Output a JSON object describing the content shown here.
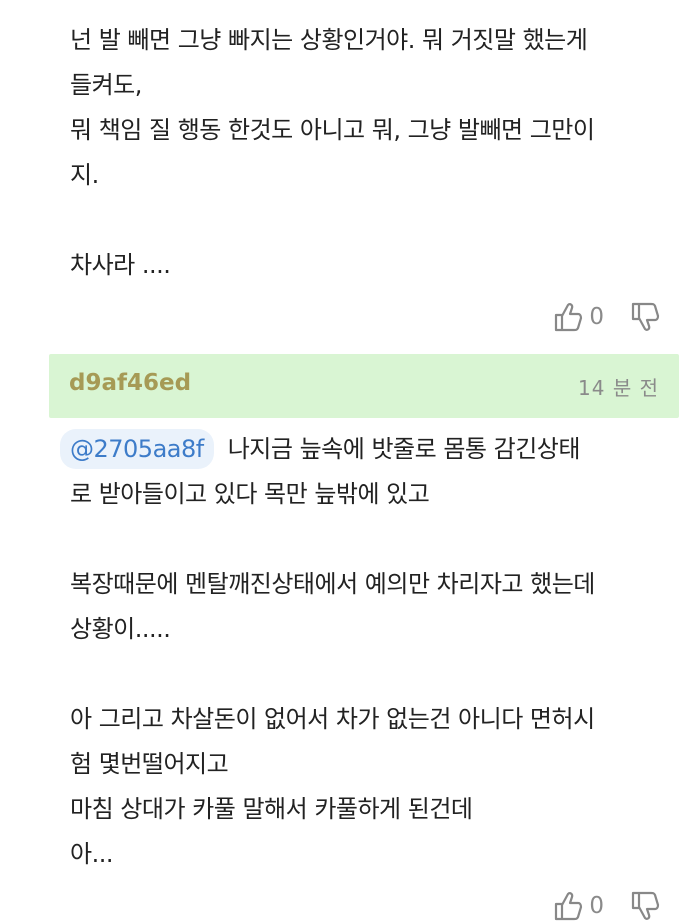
{
  "comment1": {
    "lines": [
      "넌 발 빼면 그냥 빠지는 상황인거야. 뭐 거짓말 했는게",
      "들켜도,",
      "뭐 책임 질 행동 한것도 아니고 뭐, 그냥 발빼면 그만이",
      "지.",
      "",
      "차사라 ...."
    ],
    "likes": "0",
    "like_icon": "thumbs-up-icon",
    "dislike_icon": "thumbs-down-icon"
  },
  "comment2": {
    "author": "d9af46ed",
    "time": "14 분 전",
    "mention": "@2705aa8f",
    "first_line": "나지금 늪속에 밧줄로 몸통 감긴상태",
    "lines": [
      "로 받아들이고 있다 목만 늪밖에 있고",
      "",
      "복장때문에 멘탈깨진상태에서 예의만 차리자고 했는데",
      "상황이.....",
      "",
      "아 그리고 차살돈이 없어서 차가 없는건 아니다 면허시",
      "험 몇번떨어지고",
      "마침 상대가 카풀 말해서 카풀하게 된건데",
      "아..."
    ],
    "likes": "0"
  }
}
